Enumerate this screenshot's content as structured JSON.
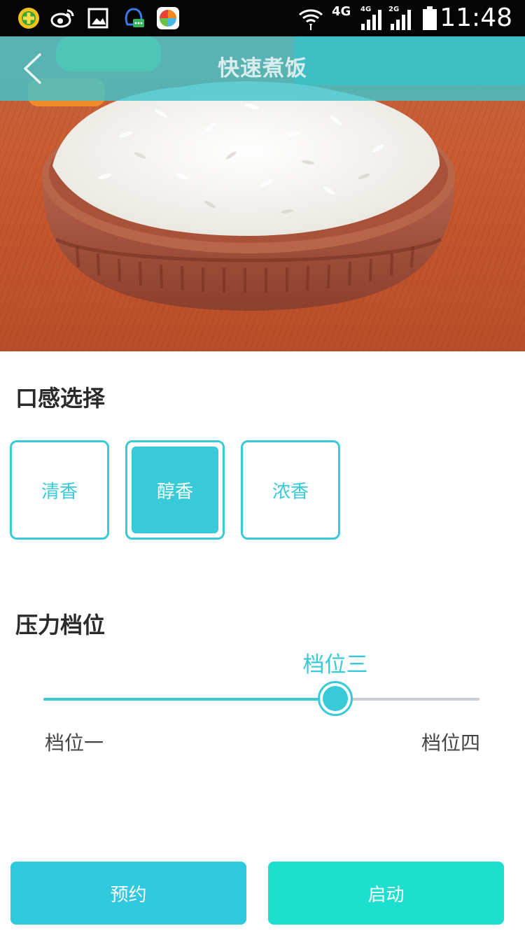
{
  "status_bar": {
    "time": "11:48",
    "network": "4G",
    "sim1": "4G",
    "sim2": "2G",
    "icons": [
      "360-app-icon",
      "weibo-icon",
      "gallery-icon",
      "qq-chat-icon",
      "game-center-icon",
      "wifi-icon",
      "signal-icon",
      "signal-icon",
      "battery-icon"
    ]
  },
  "header": {
    "title": "快速煮饭",
    "back_icon": "chevron-left-icon",
    "bar_color": "#40c4cc"
  },
  "taste": {
    "title": "口感选择",
    "options": [
      {
        "label": "清香",
        "selected": false
      },
      {
        "label": "醇香",
        "selected": true
      },
      {
        "label": "浓香",
        "selected": false
      }
    ]
  },
  "pressure": {
    "title": "压力档位",
    "current_label": "档位三",
    "min_label": "档位一",
    "max_label": "档位四",
    "value_fraction": 0.67
  },
  "actions": {
    "reserve_label": "预约",
    "start_label": "启动"
  },
  "colors": {
    "accent": "#38cad6",
    "reserve_button": "#30c8dc",
    "start_button": "#1ddfcf",
    "status_bar": "#050505"
  }
}
